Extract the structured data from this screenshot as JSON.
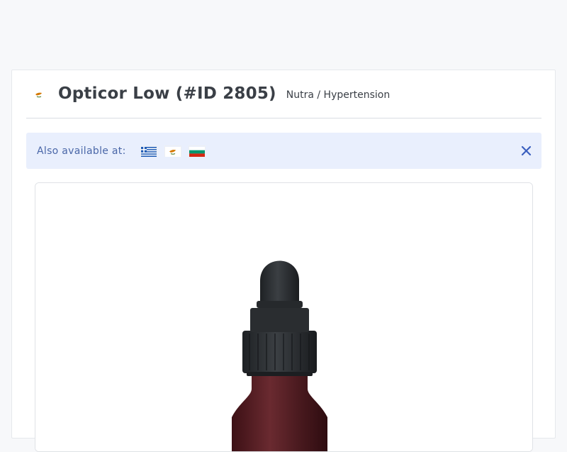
{
  "product": {
    "title": "Opticor Low (#ID 2805)",
    "subtitle": "Nutra / Hypertension",
    "country_flag": "cyprus-flag"
  },
  "availability": {
    "label": "Also available at:",
    "flags": [
      "greece-flag",
      "cyprus-flag",
      "bulgaria-flag"
    ],
    "close_icon": "close-icon"
  },
  "image": {
    "icon": "dropper-bottle-image"
  },
  "colors": {
    "alert_bg": "#e9effd",
    "alert_text": "#4a67a8",
    "close": "#3b5fbf",
    "bottle_cap": "#2b2e31",
    "bottle_glass": "#5a1f24"
  }
}
